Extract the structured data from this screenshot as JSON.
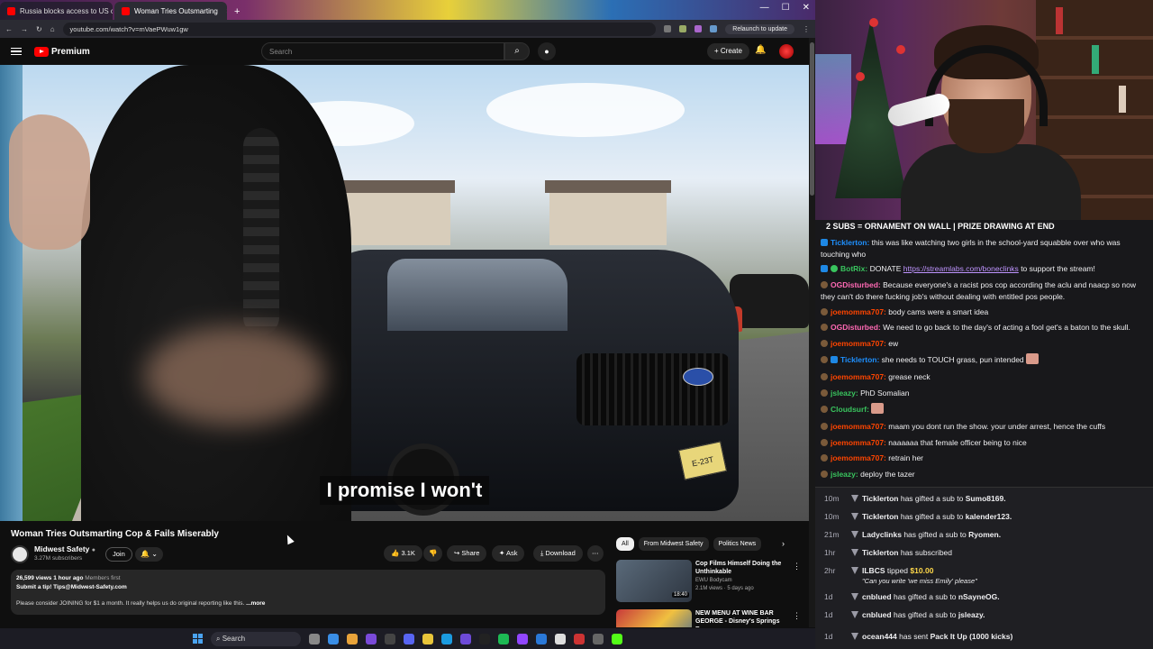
{
  "browser": {
    "tabs": [
      {
        "label": "Russia blocks access to US ch"
      },
      {
        "label": "Woman Tries Outsmarting"
      }
    ],
    "url": "youtube.com/watch?v=mVaePWuw1gw",
    "relaunch_label": "Relaunch to update"
  },
  "youtube": {
    "brand": "Premium",
    "search_placeholder": "Search",
    "create_label": "Create",
    "video": {
      "subtitle": "I promise I won't",
      "plate_text": "E-23T"
    },
    "title": "Woman Tries Outsmarting Cop & Fails Miserably",
    "channel": {
      "name": "Midwest Safety",
      "subscribers": "3.27M subscribers",
      "join_label": "Join"
    },
    "actions": {
      "likes": "3.1K",
      "share_label": "Share",
      "ask_label": "Ask",
      "download_label": "Download"
    },
    "description": {
      "stats": "26,599 views  1 hour ago",
      "members": "Members first",
      "line1": "Submit a tip! Tips@Midwest-Safety.com",
      "line2": "Please consider JOINING for $1 a month. It really helps us do original reporting like this.",
      "more_label": "...more"
    },
    "filters": [
      "All",
      "From Midwest Safety",
      "Politics News"
    ],
    "recommendations": [
      {
        "title": "Cop Films Himself Doing the Unthinkable",
        "channel": "EWU Bodycam",
        "meta": "2.1M views · 5 days ago",
        "badge": "",
        "duration": "18:40"
      },
      {
        "title": "NEW MENU AT WINE BAR GEORGE - Disney's Springs Bes...",
        "channel": "",
        "meta": "",
        "badge": "New",
        "duration": ""
      }
    ]
  },
  "chat": {
    "banner": "2 SUBS = ORNAMENT ON WALL | PRIZE DRAWING AT END",
    "messages": [
      {
        "user": "Ticklerton:",
        "text": "this was like watching two girls in the school-yard squabble over who was touching who",
        "color": "#1e90ff"
      },
      {
        "user": "BotRix:",
        "text": "DONATE",
        "link": "https://streamlabs.com/boneclinks",
        "after": "to support the stream!",
        "color": "#39c45e"
      },
      {
        "user": "OGDisturbed:",
        "text": "Because everyone's a racist pos cop according the aclu and naacp so now they can't do there fucking job's without dealing with entitled pos people.",
        "color": "#ff69b4"
      },
      {
        "user": "joemomma707:",
        "text": "body cams were a smart idea",
        "color": "#ff4500"
      },
      {
        "user": "OGDisturbed:",
        "text": "We need to go back to the day's of acting a fool get's a baton to the skull.",
        "color": "#ff69b4"
      },
      {
        "user": "joemomma707:",
        "text": "ew",
        "color": "#ff4500"
      },
      {
        "user": "Ticklerton:",
        "text": "she needs to TOUCH grass, pun intended",
        "color": "#1e90ff"
      },
      {
        "user": "joemomma707:",
        "text": "grease neck",
        "color": "#ff4500"
      },
      {
        "user": "jsleazy:",
        "text": "PhD Somalian",
        "color": "#39c45e"
      },
      {
        "user": "Cloudsurf:",
        "text": "",
        "color": "#39c45e"
      },
      {
        "user": "joemomma707:",
        "text": "maam you dont run the show. your under arrest, hence the cuffs",
        "color": "#ff4500"
      },
      {
        "user": "joemomma707:",
        "text": "naaaaaa that female officer being to nice",
        "color": "#ff4500"
      },
      {
        "user": "joemomma707:",
        "text": "retrain her",
        "color": "#ff4500"
      },
      {
        "user": "jsleazy:",
        "text": "deploy the tazer",
        "color": "#39c45e"
      }
    ],
    "events": [
      {
        "time": "10m",
        "user": "Ticklerton",
        "text": "has gifted a sub to",
        "target": "Sumo8169."
      },
      {
        "time": "10m",
        "user": "Ticklerton",
        "text": "has gifted a sub to",
        "target": "kalender123."
      },
      {
        "time": "21m",
        "user": "Ladyclinks",
        "text": "has gifted a sub to",
        "target": "Ryomen."
      },
      {
        "time": "1hr",
        "user": "Ticklerton",
        "text": "has subscribed",
        "target": ""
      },
      {
        "time": "2hr",
        "user": "ILBCS",
        "text": "tipped",
        "target": "$10.00",
        "quote": "\"Can you write 'we miss Emily' please\""
      },
      {
        "time": "1d",
        "user": "cnblued",
        "text": "has gifted a sub to",
        "target": "nSayneOG."
      },
      {
        "time": "1d",
        "user": "cnblued",
        "text": "has gifted a sub to",
        "target": "jsleazy."
      },
      {
        "time": "1d",
        "user": "ocean444",
        "text": "has sent",
        "target": "Pack It Up (1000 kicks)"
      }
    ]
  },
  "taskbar": {
    "search_label": "Search"
  },
  "colors": {
    "yt_red": "#ff0000",
    "chat_bg": "#18181b"
  }
}
